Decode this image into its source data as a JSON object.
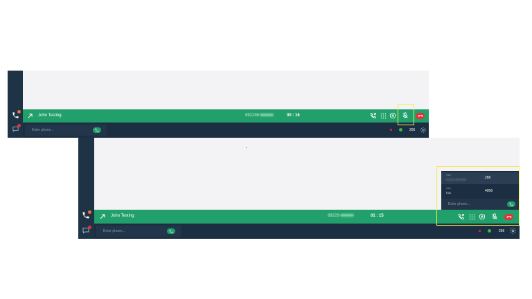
{
  "call": {
    "caller_name": "John Testing",
    "number_prefix": "89229",
    "shot1_number_prefix": "892298",
    "timer_first": "00 : 16",
    "timer_second": "01 : 15"
  },
  "dialpad": {
    "placeholder": "Enter phone..."
  },
  "status": {
    "extension": "266"
  },
  "transfer_panel": {
    "items": [
      {
        "label": "User",
        "name": "Kirsty Michelle",
        "extension": "266"
      },
      {
        "label": "User",
        "name": "Kat",
        "extension": "4006"
      }
    ],
    "placeholder": "Enter phone..."
  },
  "sidebar": {
    "chat_badge": "10"
  },
  "colors": {
    "call_bar": "#22a06b",
    "sidebar": "#1f3346",
    "bottom_bar": "#1c2e41",
    "hangup": "#e53238",
    "highlight": "#f5ea4a"
  }
}
